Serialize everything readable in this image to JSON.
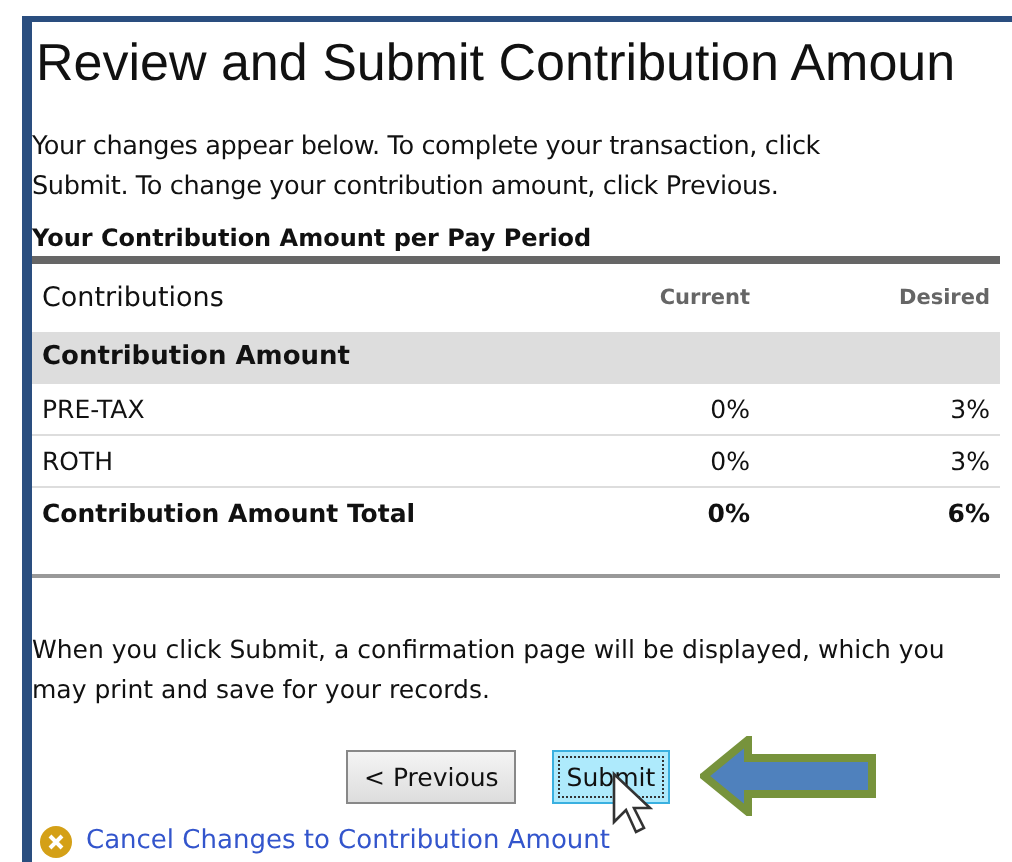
{
  "title": "Review and Submit Contribution Amoun",
  "intro": "Your changes appear below. To complete your transaction, click Submit. To change your contribution amount, click Previous.",
  "section_title": "Your Contribution Amount per Pay Period",
  "table": {
    "columns": [
      "Contributions",
      "Current",
      "Desired"
    ],
    "rows": [
      {
        "kind": "group",
        "label": "Contribution Amount"
      },
      {
        "kind": "item",
        "label": "PRE-TAX",
        "current": "0%",
        "desired": "3%"
      },
      {
        "kind": "item",
        "label": "ROTH",
        "current": "0%",
        "desired": "3%"
      },
      {
        "kind": "total",
        "label": "Contribution Amount Total",
        "current": "0%",
        "desired": "6%"
      }
    ]
  },
  "note": "When you click Submit, a confirmation page will be displayed, which you may print and save for your records.",
  "buttons": [
    {
      "label": "< Previous",
      "selected": false
    },
    {
      "label": "Submit",
      "selected": true
    }
  ],
  "cancel_link": "Cancel Changes to Contribution Amount"
}
